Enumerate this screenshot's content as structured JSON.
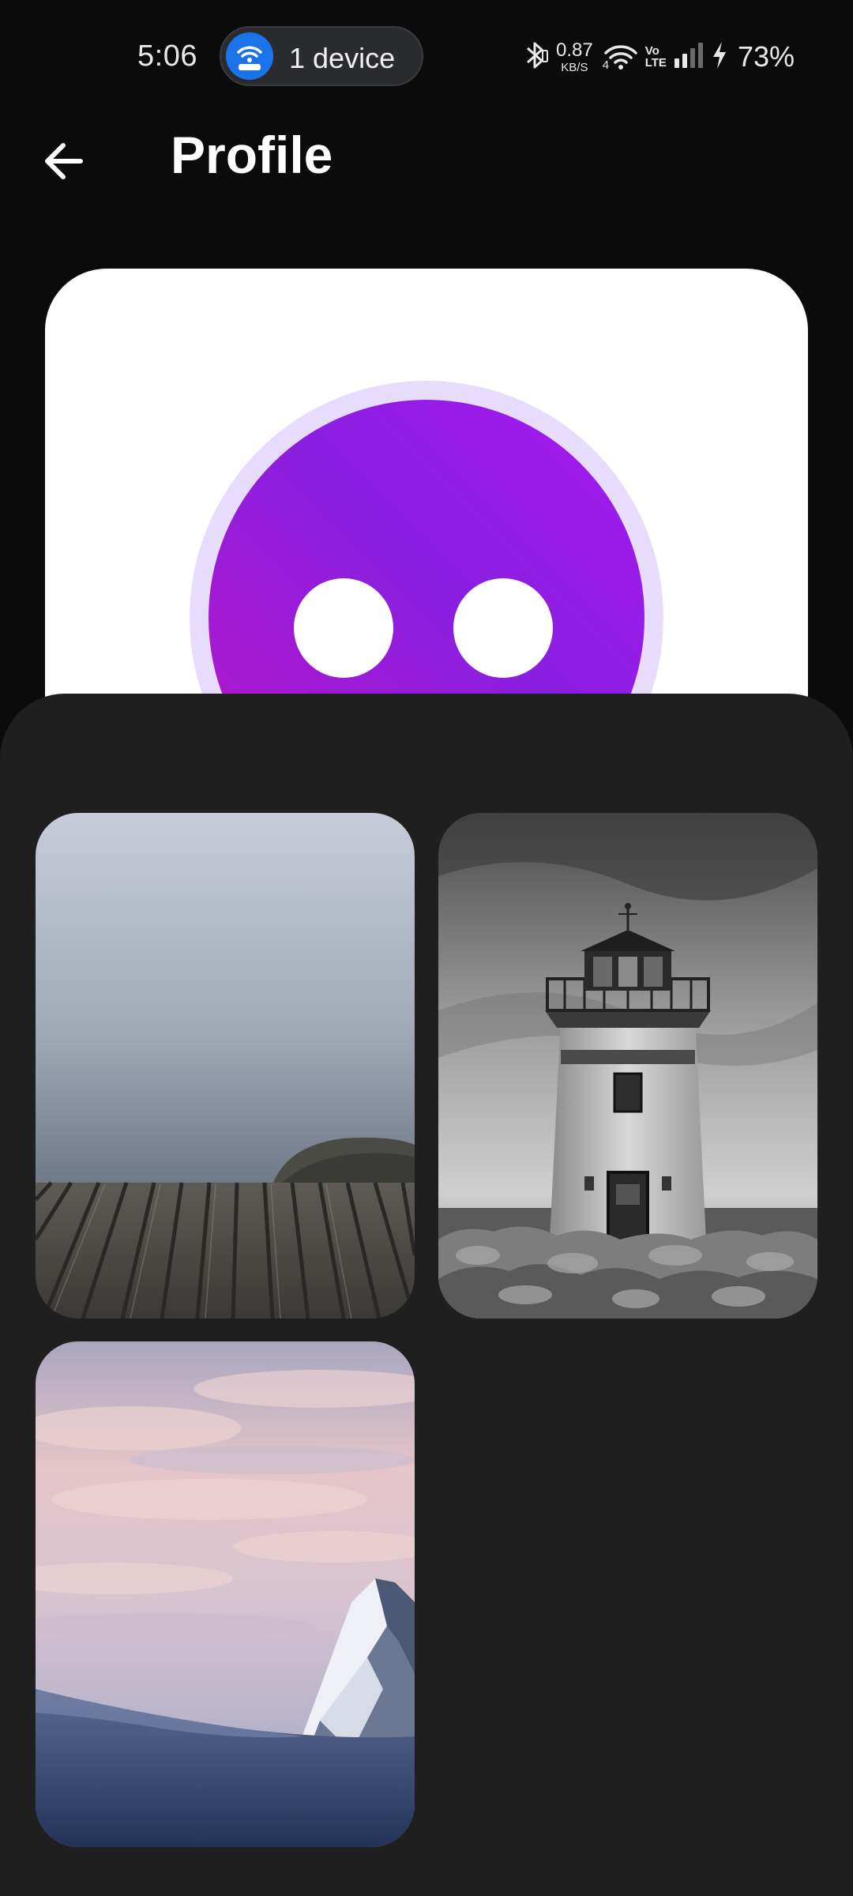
{
  "status_bar": {
    "time": "5:06",
    "hotspot_label": "1 device",
    "net_speed_value": "0.87",
    "net_speed_unit": "KB/S",
    "volte_top": "Vo",
    "volte_bottom": "LTE",
    "wifi_generation": "4",
    "battery": "73%"
  },
  "header": {
    "title": "Profile"
  },
  "avatar": {
    "face_color": "#9b1ae6",
    "ring_color": "#e7dcfb"
  },
  "wallpapers": [
    {
      "name": "boardwalk-sky"
    },
    {
      "name": "lighthouse-bw"
    },
    {
      "name": "snowy-mountain-sunset"
    }
  ],
  "icons": {
    "back": "arrow-left-icon",
    "hotspot": "hotspot-icon",
    "bluetooth": "bluetooth-icon",
    "wifi": "wifi-icon",
    "signal": "signal-icon",
    "charging": "charging-icon"
  },
  "colors": {
    "background": "#0b0b0c",
    "sheet": "#1f1f20",
    "accent_blue": "#1a73e8"
  }
}
